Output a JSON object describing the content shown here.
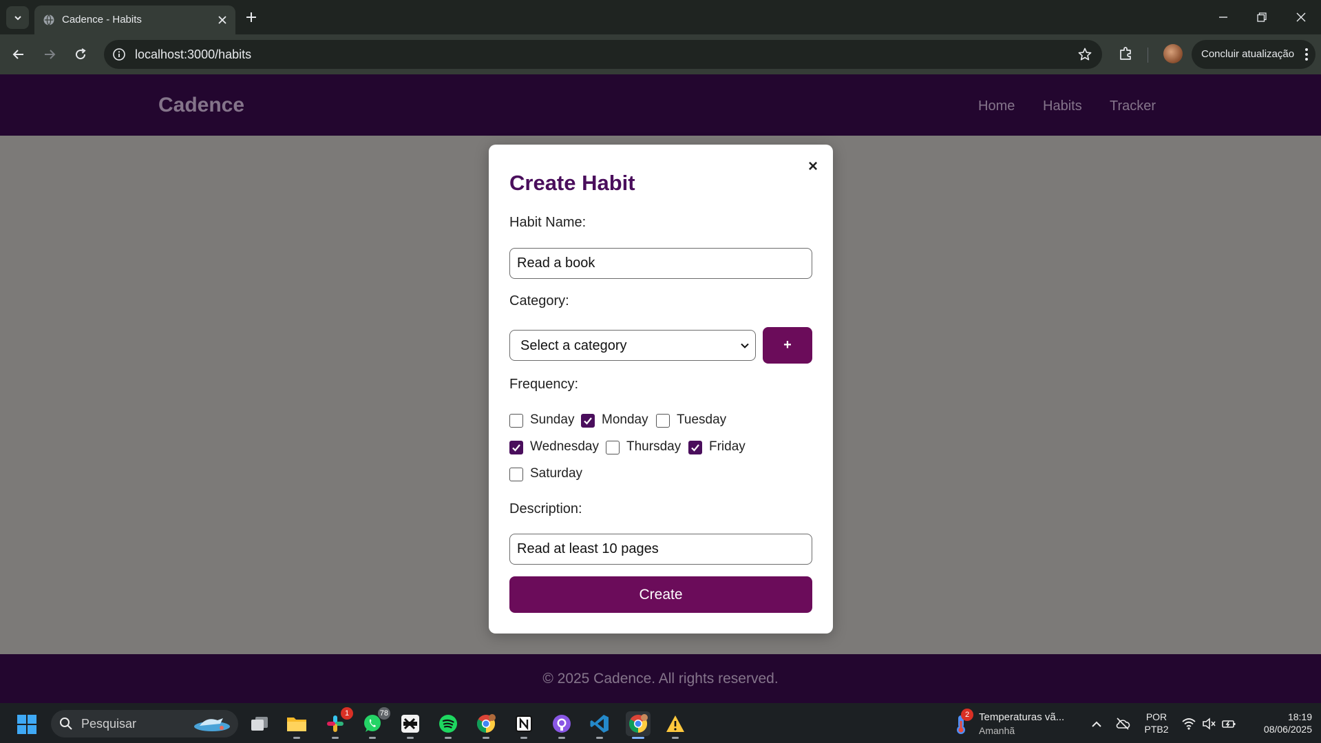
{
  "browser": {
    "tab_title": "Cadence - Habits",
    "url": "localhost:3000/habits",
    "update_label": "Concluir atualização"
  },
  "site": {
    "brand": "Cadence",
    "nav": [
      "Home",
      "Habits",
      "Tracker"
    ],
    "footer": "© 2025 Cadence. All rights reserved."
  },
  "modal": {
    "title": "Create Habit",
    "close_symbol": "×",
    "habit_name_label": "Habit Name:",
    "habit_name_value": "Read a book",
    "category_label": "Category:",
    "category_selected": "Select a category",
    "add_category_label": "+",
    "frequency_label": "Frequency:",
    "days": [
      {
        "label": "Sunday",
        "checked": false
      },
      {
        "label": "Monday",
        "checked": true
      },
      {
        "label": "Tuesday",
        "checked": false
      },
      {
        "label": "Wednesday",
        "checked": true
      },
      {
        "label": "Thursday",
        "checked": false
      },
      {
        "label": "Friday",
        "checked": true
      },
      {
        "label": "Saturday",
        "checked": false
      }
    ],
    "description_label": "Description:",
    "description_value": "Read at least 10 pages",
    "create_label": "Create"
  },
  "taskbar": {
    "search_placeholder": "Pesquisar",
    "apps": [
      {
        "name": "task-view",
        "badge": ""
      },
      {
        "name": "file-explorer",
        "badge": ""
      },
      {
        "name": "slack",
        "badge": "1"
      },
      {
        "name": "whatsapp",
        "badge": "78"
      },
      {
        "name": "capcut",
        "badge": ""
      },
      {
        "name": "spotify",
        "badge": ""
      },
      {
        "name": "chrome-profile",
        "badge": ""
      },
      {
        "name": "notion",
        "badge": ""
      },
      {
        "name": "github-desktop",
        "badge": ""
      },
      {
        "name": "vscode",
        "badge": ""
      },
      {
        "name": "chrome",
        "badge": ""
      },
      {
        "name": "warning",
        "badge": ""
      }
    ],
    "weather_title": "Temperaturas vã...",
    "weather_sub": "Amanhã",
    "weather_badge": "2",
    "lang_top": "POR",
    "lang_bottom": "PTB2",
    "time": "18:19",
    "date": "08/06/2025"
  },
  "colors": {
    "header_bg": "#23062f",
    "accent": "#6b0c5a",
    "title": "#4a0e5c",
    "overlay": "#7c7a78"
  }
}
